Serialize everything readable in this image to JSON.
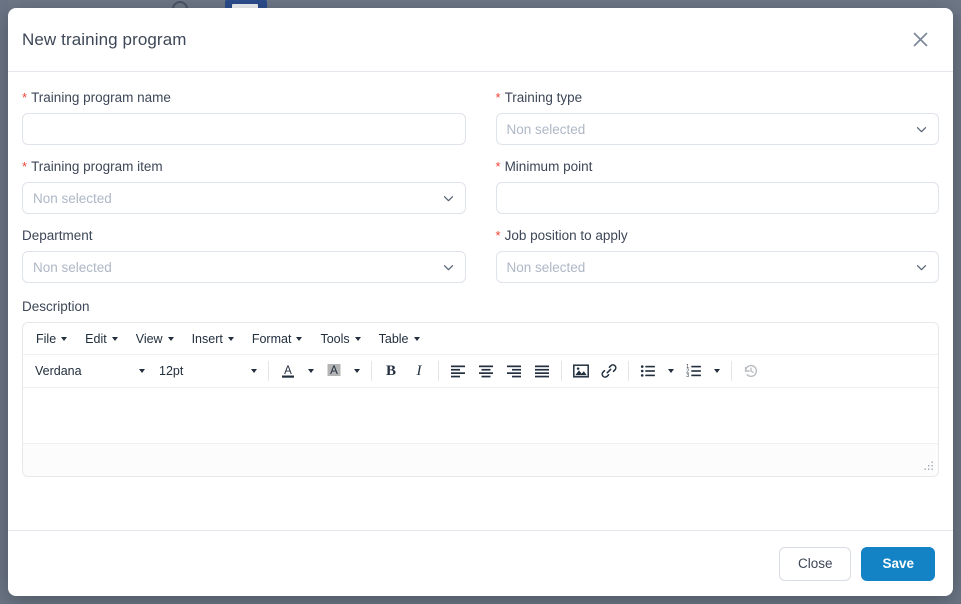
{
  "backdrop": {
    "color": "#6b7585"
  },
  "dialog": {
    "title": "New training program",
    "close_icon": "close-icon"
  },
  "form": {
    "fields": [
      {
        "label": "Training program name",
        "required": true,
        "type": "text",
        "value": "",
        "placeholder": ""
      },
      {
        "label": "Training type",
        "required": true,
        "type": "select",
        "value": "",
        "placeholder": "Non selected"
      },
      {
        "label": "Training program item",
        "required": true,
        "type": "select",
        "value": "",
        "placeholder": "Non selected"
      },
      {
        "label": "Minimum point",
        "required": true,
        "type": "text",
        "value": "",
        "placeholder": ""
      },
      {
        "label": "Department",
        "required": false,
        "type": "select",
        "value": "",
        "placeholder": "Non selected"
      },
      {
        "label": "Job position to apply",
        "required": true,
        "type": "select",
        "value": "",
        "placeholder": "Non selected"
      }
    ],
    "required_marker": "*"
  },
  "description": {
    "label": "Description",
    "content": "",
    "editor": {
      "menubar": [
        {
          "label": "File"
        },
        {
          "label": "Edit"
        },
        {
          "label": "View"
        },
        {
          "label": "Insert"
        },
        {
          "label": "Format"
        },
        {
          "label": "Tools"
        },
        {
          "label": "Table"
        }
      ],
      "font_family": "Verdana",
      "font_size": "12pt",
      "buttons": [
        {
          "name": "text-color-icon",
          "title": "Text color"
        },
        {
          "name": "background-color-icon",
          "title": "Background color"
        },
        {
          "name": "bold-icon",
          "title": "Bold",
          "glyph": "B"
        },
        {
          "name": "italic-icon",
          "title": "Italic",
          "glyph": "I"
        },
        {
          "name": "align-left-icon",
          "title": "Align left"
        },
        {
          "name": "align-center-icon",
          "title": "Align center"
        },
        {
          "name": "align-right-icon",
          "title": "Align right"
        },
        {
          "name": "justify-icon",
          "title": "Justify"
        },
        {
          "name": "image-icon",
          "title": "Insert image"
        },
        {
          "name": "link-icon",
          "title": "Insert link"
        },
        {
          "name": "bullet-list-icon",
          "title": "Bullet list"
        },
        {
          "name": "numbered-list-icon",
          "title": "Numbered list"
        },
        {
          "name": "restore-draft-icon",
          "title": "Restore last draft"
        }
      ],
      "resize_handle": "resize-grip-icon"
    }
  },
  "footer": {
    "close_label": "Close",
    "save_label": "Save"
  },
  "colors": {
    "accent": "#1383c6",
    "required": "#f04438",
    "text": "#3d4757",
    "placeholder": "#aeb7c6",
    "border": "#dfe3ea",
    "backdrop": "#6b7585"
  }
}
